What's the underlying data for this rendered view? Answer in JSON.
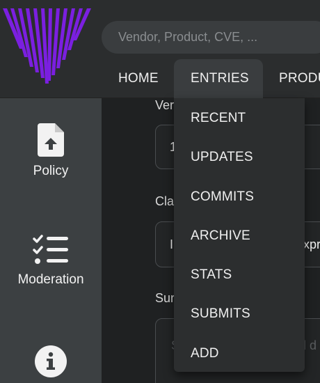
{
  "search": {
    "placeholder": "Vendor, Product, CVE, ..."
  },
  "nav": {
    "home": "HOME",
    "entries": "ENTRIES",
    "products": "PRODU"
  },
  "dropdown": {
    "items": [
      "RECENT",
      "UPDATES",
      "COMMITS",
      "ARCHIVE",
      "STATS",
      "SUBMITS",
      "ADD"
    ]
  },
  "sidebar": {
    "policy": "Policy",
    "moderation": "Moderation"
  },
  "form": {
    "field1_label": "Ver",
    "field1_value": "1",
    "field2_label": "Cla",
    "field2_value_left": "I",
    "field2_value_right": "xpr",
    "field3_label": "Sur",
    "field3_placeholder_left": "S",
    "field3_placeholder_right": "l d"
  },
  "colors": {
    "accent": "#7b1fe0",
    "header": "#2b2d2e",
    "sidebar": "#3c4042",
    "dropdown": "#2c2e2f"
  }
}
